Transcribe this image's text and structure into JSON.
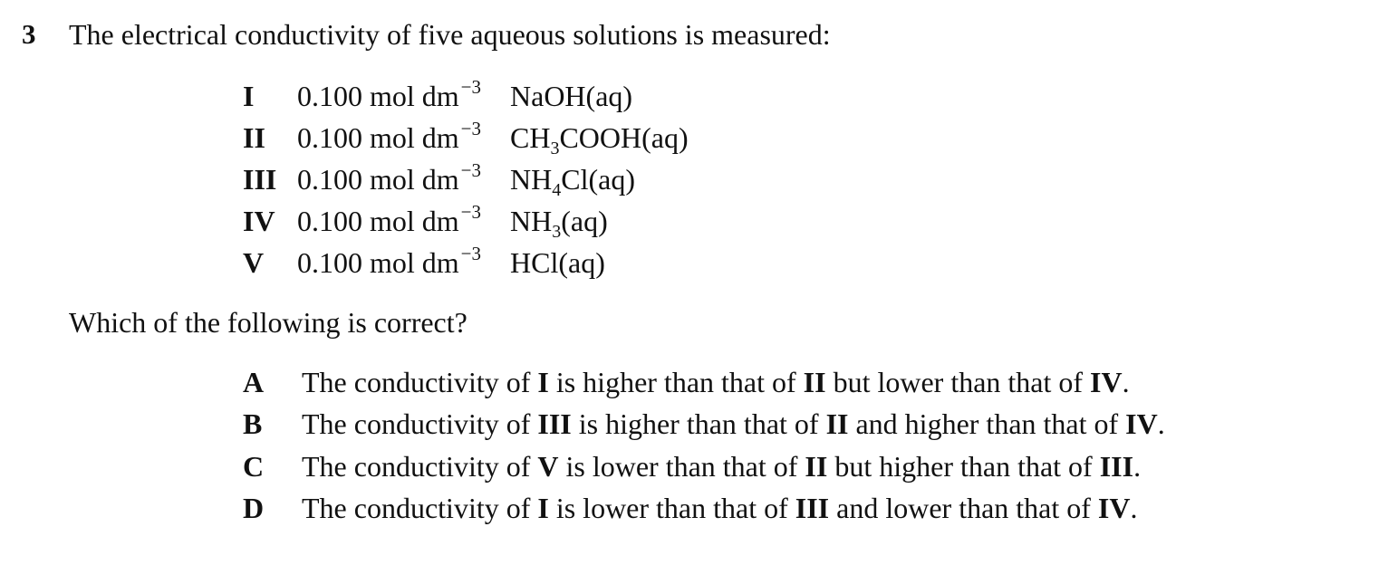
{
  "question": {
    "number": "3",
    "stem": "The electrical conductivity of five aqueous solutions is measured:",
    "prompt": "Which of the following is correct?"
  },
  "solutions": [
    {
      "label": "I",
      "concentration": "0.100 mol dm",
      "exponent": "−3",
      "species": [
        {
          "t": "NaOH(aq)",
          "sub": false
        }
      ]
    },
    {
      "label": "II",
      "concentration": "0.100 mol dm",
      "exponent": "−3",
      "species": [
        {
          "t": "CH",
          "sub": false
        },
        {
          "t": "3",
          "sub": true
        },
        {
          "t": "COOH(aq)",
          "sub": false
        }
      ]
    },
    {
      "label": "III",
      "concentration": "0.100 mol dm",
      "exponent": "−3",
      "species": [
        {
          "t": "NH",
          "sub": false
        },
        {
          "t": "4",
          "sub": true
        },
        {
          "t": "Cl(aq)",
          "sub": false
        }
      ]
    },
    {
      "label": "IV",
      "concentration": "0.100 mol dm",
      "exponent": "−3",
      "species": [
        {
          "t": "NH",
          "sub": false
        },
        {
          "t": "3",
          "sub": true
        },
        {
          "t": "(aq)",
          "sub": false
        }
      ]
    },
    {
      "label": "V",
      "concentration": "0.100 mol dm",
      "exponent": "−3",
      "species": [
        {
          "t": "HCl(aq)",
          "sub": false
        }
      ]
    }
  ],
  "options": [
    {
      "letter": "A",
      "parts": [
        {
          "t": "The conductivity of ",
          "b": false
        },
        {
          "t": "I",
          "b": true
        },
        {
          "t": " is higher than that of ",
          "b": false
        },
        {
          "t": "II",
          "b": true
        },
        {
          "t": " but lower than that of ",
          "b": false
        },
        {
          "t": "IV",
          "b": true
        },
        {
          "t": ".",
          "b": false
        }
      ]
    },
    {
      "letter": "B",
      "parts": [
        {
          "t": "The conductivity of ",
          "b": false
        },
        {
          "t": "III",
          "b": true
        },
        {
          "t": " is higher than that of ",
          "b": false
        },
        {
          "t": "II",
          "b": true
        },
        {
          "t": " and higher than that of ",
          "b": false
        },
        {
          "t": "IV",
          "b": true
        },
        {
          "t": ".",
          "b": false
        }
      ]
    },
    {
      "letter": "C",
      "parts": [
        {
          "t": "The conductivity of ",
          "b": false
        },
        {
          "t": "V",
          "b": true
        },
        {
          "t": " is lower than that of ",
          "b": false
        },
        {
          "t": "II",
          "b": true
        },
        {
          "t": " but higher than that of ",
          "b": false
        },
        {
          "t": "III",
          "b": true
        },
        {
          "t": ".",
          "b": false
        }
      ]
    },
    {
      "letter": "D",
      "parts": [
        {
          "t": "The conductivity of ",
          "b": false
        },
        {
          "t": "I",
          "b": true
        },
        {
          "t": " is lower than that of ",
          "b": false
        },
        {
          "t": "III",
          "b": true
        },
        {
          "t": " and lower than that of ",
          "b": false
        },
        {
          "t": "IV",
          "b": true
        },
        {
          "t": ".",
          "b": false
        }
      ]
    }
  ]
}
